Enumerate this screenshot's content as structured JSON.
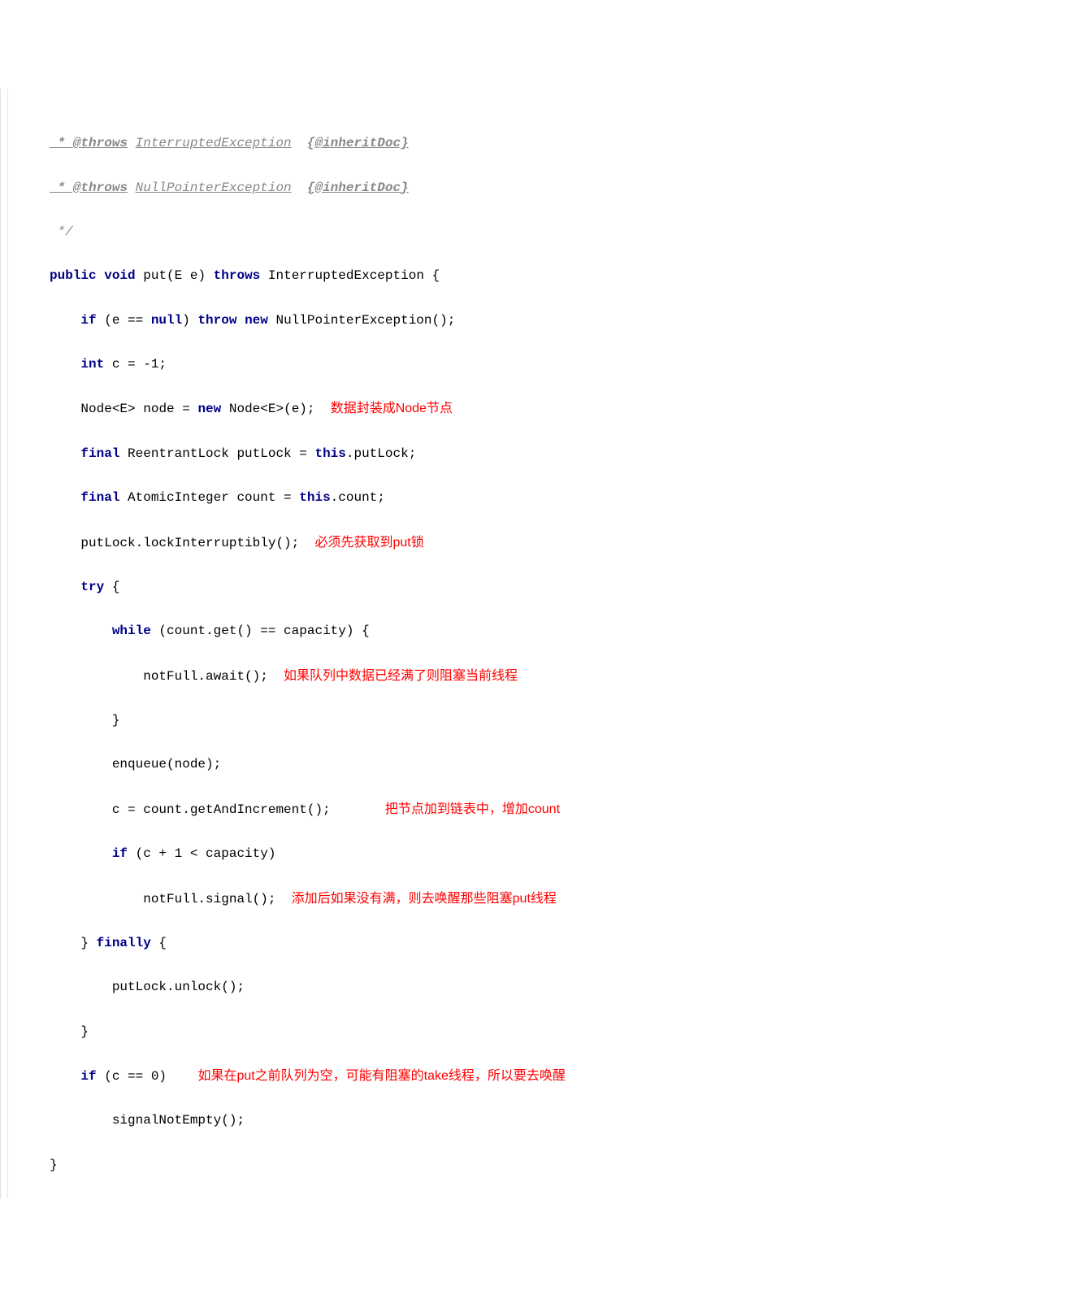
{
  "code": {
    "javadoc_throws1_tag": " * @throws",
    "javadoc_throws1_exc": "InterruptedException",
    "javadoc_inherit1": "{@inheritDoc}",
    "javadoc_throws2_tag": " * @throws",
    "javadoc_throws2_exc": "NullPointerException",
    "javadoc_inherit2": "{@inheritDoc}",
    "javadoc_end": " */",
    "kw_public": "public",
    "kw_void": "void",
    "method_put": "put",
    "type_E": "E",
    "param_e": " e) ",
    "kw_throws": "throws",
    "type_InterruptedException": " InterruptedException ",
    "brace_open": "{",
    "kw_if1": "if",
    "cond_null": " (e == ",
    "kw_null": "null",
    "paren_close": ") ",
    "kw_throw": "throw",
    "kw_new1": "new",
    "type_NPE": " NullPointerException();",
    "kw_int": "int",
    "var_c_init": " c = -1;",
    "type_Node1": "Node<",
    "type_E2": "E",
    "gt_node": "> node = ",
    "kw_new2": "new",
    "type_Node2": " Node<",
    "type_E3": "E",
    "node_ctor": ">(e);  ",
    "annotation1": "数据封装成Node节点",
    "kw_final1": "final",
    "type_ReentrantLock": " ReentrantLock putLock = ",
    "kw_this1": "this",
    "field_putLock": ".putLock;",
    "kw_final2": "final",
    "type_AtomicInteger": " AtomicInteger count = ",
    "kw_this2": "this",
    "field_count": ".count;",
    "call_lockInterruptibly": "putLock.lockInterruptibly();  ",
    "annotation2": "必须先获取到put锁",
    "kw_try": "try",
    "try_brace": " {",
    "kw_while": "while",
    "while_cond": " (count.get() == capacity) {",
    "call_await": "notFull.await();  ",
    "annotation3": "如果队列中数据已经满了则阻塞当前线程",
    "while_close": "}",
    "call_enqueue": "enqueue(node);",
    "call_getAndIncrement": "c = count.getAndIncrement();",
    "annotation4": "把节点加到链表中，增加count",
    "kw_if2": "if",
    "if_cond2": " (c + 1 < capacity)",
    "call_signal": "notFull.signal();  ",
    "annotation5": "添加后如果没有满，则去唤醒那些阻塞put线程",
    "try_close": "} ",
    "kw_finally": "finally",
    "finally_brace": " {",
    "call_unlock": "putLock.unlock();",
    "finally_close": "}",
    "kw_if3": "if",
    "if_cond3": " (c == 0)",
    "annotation6_prefix": "    ",
    "annotation6": "如果在put之前队列为空，可能有阻塞的take线程，所以要去唤醒",
    "call_signalNotEmpty": "signalNotEmpty();",
    "method_close": "}"
  }
}
